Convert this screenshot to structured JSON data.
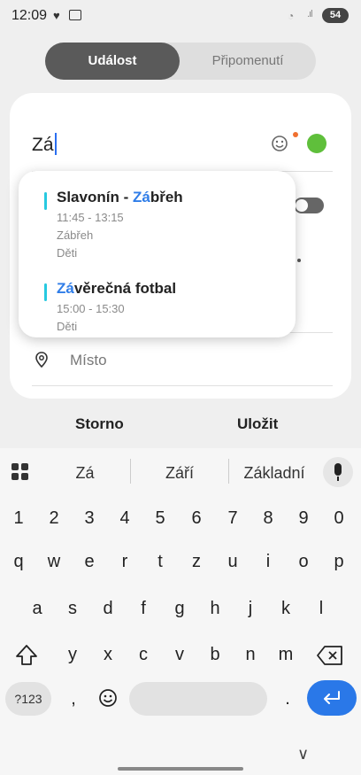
{
  "status_bar": {
    "time": "12:09",
    "battery": "54"
  },
  "tabs": [
    {
      "label": "Událost",
      "active": true
    },
    {
      "label": "Připomenutí",
      "active": false
    }
  ],
  "event": {
    "title_value": "Zá",
    "color": "#5fbf3b",
    "location_placeholder": "Místo"
  },
  "suggestions": [
    {
      "name_before": "Slavonín - ",
      "name_match": "Zá",
      "name_after": "břeh",
      "time": "11:45 - 13:15",
      "location": "Zábřeh",
      "calendar": "Děti"
    },
    {
      "name_before": "",
      "name_match": "Zá",
      "name_after": "věrečná fotbal",
      "time": "15:00 - 15:30",
      "location": "",
      "calendar": "Děti"
    }
  ],
  "actions": {
    "cancel": "Storno",
    "save": "Uložit"
  },
  "keyboard": {
    "word_suggestions": [
      "Zá",
      "Září",
      "Základní"
    ],
    "number_row": [
      "1",
      "2",
      "3",
      "4",
      "5",
      "6",
      "7",
      "8",
      "9",
      "0"
    ],
    "row1": [
      "q",
      "w",
      "e",
      "r",
      "t",
      "z",
      "u",
      "i",
      "o",
      "p"
    ],
    "row2": [
      "a",
      "s",
      "d",
      "f",
      "g",
      "h",
      "j",
      "k",
      "l"
    ],
    "row3": [
      "y",
      "x",
      "c",
      "v",
      "b",
      "n",
      "m"
    ],
    "symbols_key": "?123",
    "comma": ",",
    "period": "."
  },
  "colors": {
    "accent": "#2a78e8",
    "event_bar": "#27c9e0",
    "highlight": "#2f7de8"
  }
}
